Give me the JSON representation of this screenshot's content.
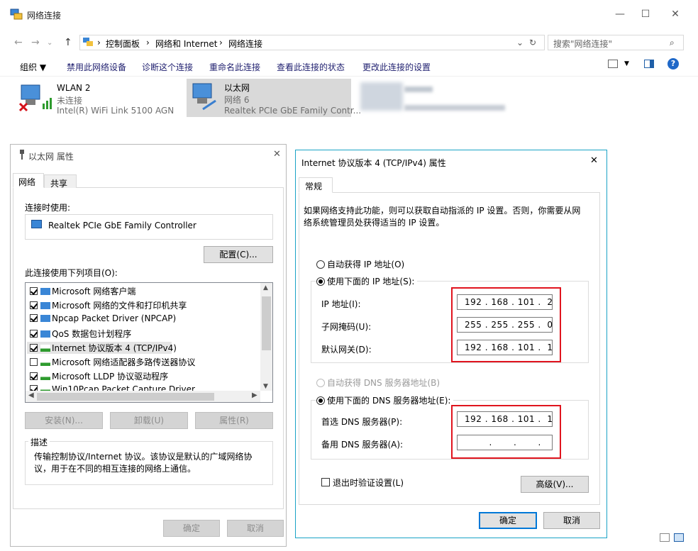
{
  "window": {
    "title": "网络连接",
    "controls": [
      "—",
      "☐",
      "✕"
    ]
  },
  "address": {
    "breadcrumbs": [
      "控制面板",
      "网络和 Internet",
      "网络连接"
    ],
    "search_placeholder": "搜索\"网络连接\""
  },
  "toolbar": {
    "items": [
      "组织 ▼",
      "禁用此网络设备",
      "诊断这个连接",
      "重命名此连接",
      "查看此连接的状态",
      "更改此连接的设置"
    ]
  },
  "connections": [
    {
      "name": "WLAN 2",
      "status": "未连接",
      "adapter": "Intel(R) WiFi Link 5100 AGN"
    },
    {
      "name": "以太网",
      "status": "网络 6",
      "adapter": "Realtek PCIe GbE Family Contr..."
    }
  ],
  "eth_props": {
    "title": "以太网 属性",
    "tabs": [
      "网络",
      "共享"
    ],
    "connect_using_label": "连接时使用:",
    "adapter": "Realtek PCIe GbE Family Controller",
    "configure_button": "配置(C)...",
    "items_label": "此连接使用下列项目(O):",
    "items": [
      {
        "label": "Microsoft 网络客户端",
        "checked": true
      },
      {
        "label": "Microsoft 网络的文件和打印机共享",
        "checked": true
      },
      {
        "label": "Npcap Packet Driver (NPCAP)",
        "checked": true
      },
      {
        "label": "QoS 数据包计划程序",
        "checked": true
      },
      {
        "label": "Internet 协议版本 4 (TCP/IPv4)",
        "checked": true
      },
      {
        "label": "Microsoft 网络适配器多路传送器协议",
        "checked": false
      },
      {
        "label": "Microsoft LLDP 协议驱动程序",
        "checked": true
      },
      {
        "label": "Win10Pcap Packet Capture Driver",
        "checked": true
      }
    ],
    "install_button": "安装(N)...",
    "uninstall_button": "卸载(U)",
    "properties_button": "属性(R)",
    "description_label": "描述",
    "description": "传输控制协议/Internet 协议。该协议是默认的广域网络协议，用于在不同的相互连接的网络上通信。",
    "ok_button": "确定",
    "cancel_button": "取消"
  },
  "ipv4": {
    "title": "Internet 协议版本 4 (TCP/IPv4) 属性",
    "tab": "常规",
    "intro": "如果网络支持此功能，则可以获取自动指派的 IP 设置。否则，你需要从网络系统管理员处获得适当的 IP 设置。",
    "auto_ip": "自动获得 IP 地址(O)",
    "manual_ip": "使用下面的 IP 地址(S):",
    "ip_label": "IP 地址(I):",
    "ip_value": "192 . 168 . 101 .  2",
    "mask_label": "子网掩码(U):",
    "mask_value": "255 . 255 . 255 .  0",
    "gateway_label": "默认网关(D):",
    "gateway_value": "192 . 168 . 101 .  1",
    "auto_dns": "自动获得 DNS 服务器地址(B)",
    "manual_dns": "使用下面的 DNS 服务器地址(E):",
    "pref_dns_label": "首选 DNS 服务器(P):",
    "pref_dns_value": "192 . 168 . 101 .  1",
    "alt_dns_label": "备用 DNS 服务器(A):",
    "alt_dns_value": "        .       .       .",
    "validate_label": "退出时验证设置(L)",
    "advanced_button": "高级(V)...",
    "ok_button": "确定",
    "cancel_button": "取消"
  },
  "colors": {
    "accent": "#0078d7",
    "highlight_red": "#e0141e",
    "dialog_header": "#ffffff"
  }
}
